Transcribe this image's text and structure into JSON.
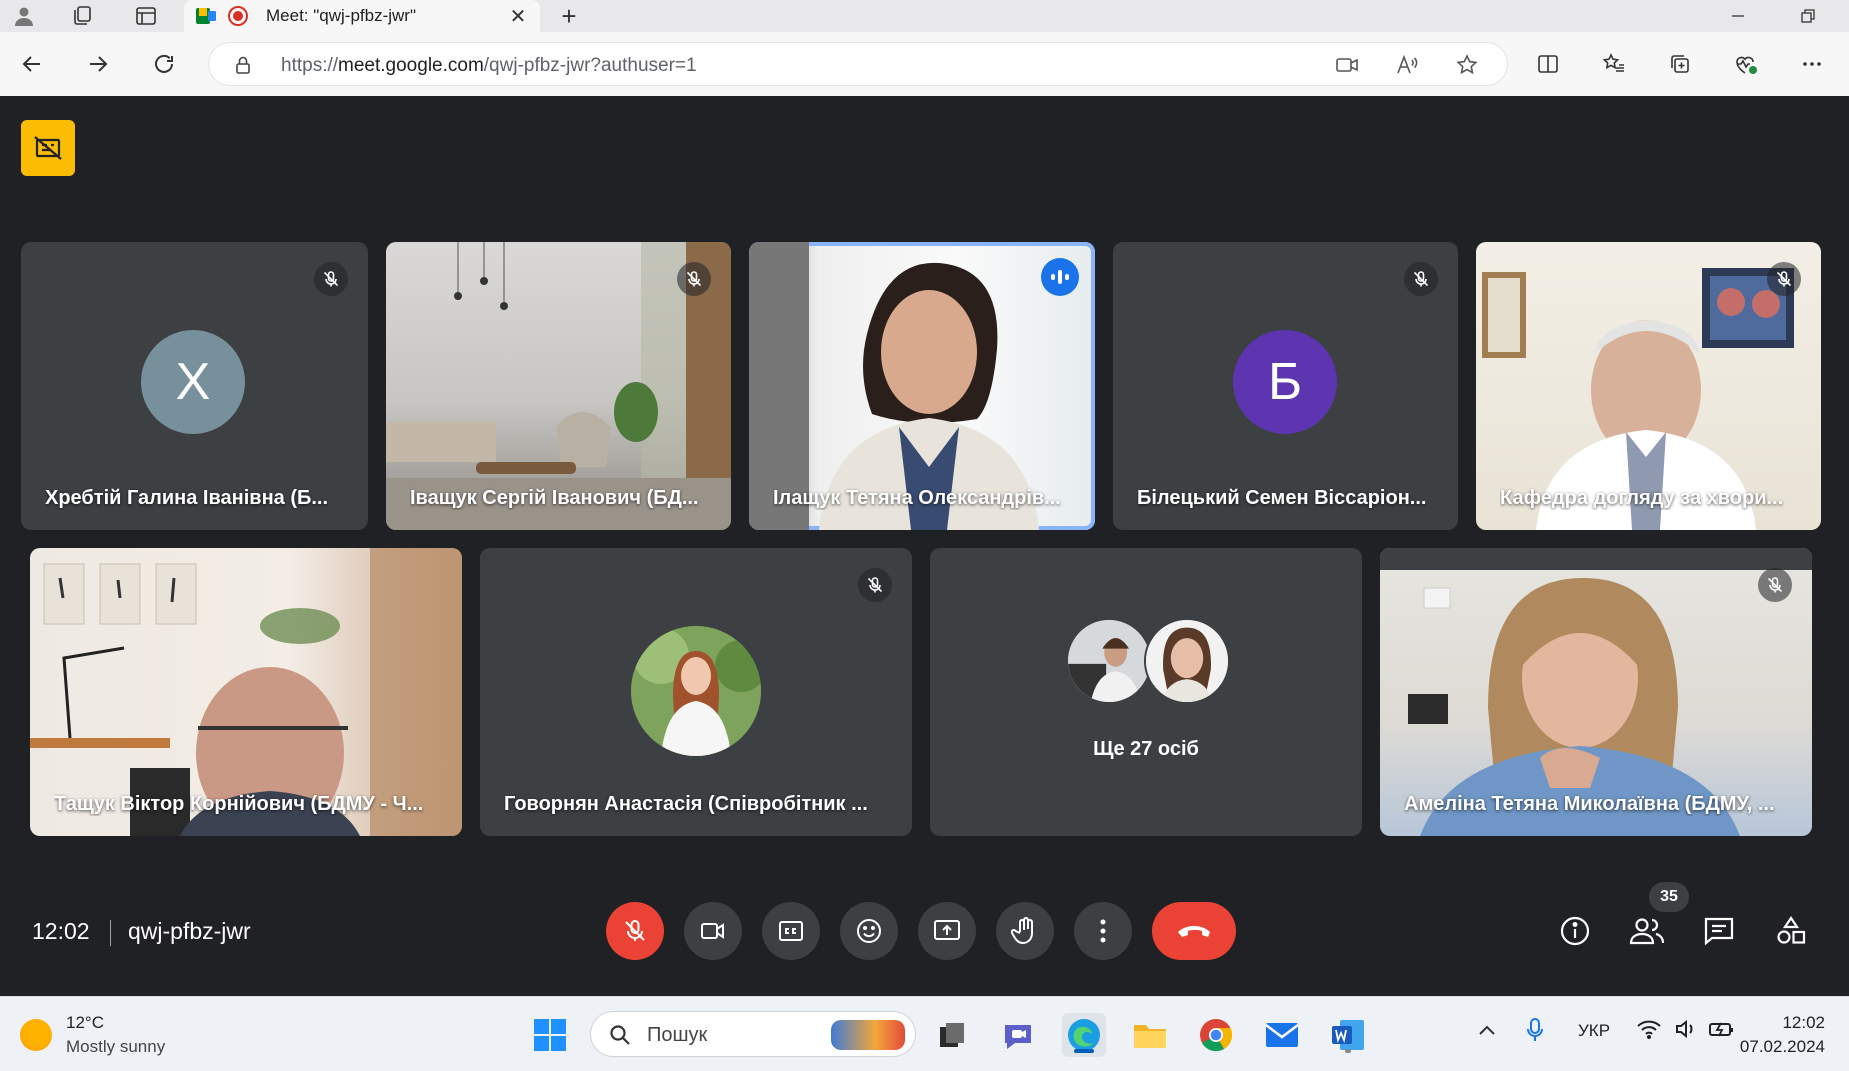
{
  "browser": {
    "tab_title": "Meet: \"qwj-pfbz-jwr\"",
    "url_prefix": "https://",
    "url_domain": "meet.google.com",
    "url_path": "/qwj-pfbz-jwr?authuser=1"
  },
  "meet": {
    "tiles_row1": [
      {
        "name": "Хребтій Галина Іванівна (Б...",
        "avatar_letter": "Х",
        "avatar_color": "#78909c",
        "muted": true
      },
      {
        "name": "Іващук Сергій Іванович (БД...",
        "muted": true
      },
      {
        "name": "Ілащук Тетяна Олександрів...",
        "speaking": true
      },
      {
        "name": "Білецький Семен Віссаріон...",
        "avatar_letter": "Б",
        "avatar_color": "#5e35b1",
        "muted": true
      },
      {
        "name": "Кафедра догляду за хвори...",
        "muted": true
      }
    ],
    "tiles_row2": [
      {
        "name": "Тащук Віктор Корнійович (БДМУ - Ч..."
      },
      {
        "name": "Говорнян Анастасія (Співробітник ...",
        "muted": true
      },
      {
        "more_label": "Ще 27 осіб"
      },
      {
        "name": "Амеліна Тетяна Миколаївна (БДМУ, ...",
        "muted": true
      }
    ],
    "time": "12:02",
    "meeting_code": "qwj-pfbz-jwr",
    "participants_count": "35",
    "colors": {
      "accent": "#1a73e8",
      "danger": "#ea4335",
      "tile": "#3c4043",
      "background": "#202124",
      "highlight": "#fbbc04"
    }
  },
  "taskbar": {
    "weather_temp": "12°C",
    "weather_condition": "Mostly sunny",
    "search_placeholder": "Пошук",
    "language": "УКР",
    "clock_time": "12:02",
    "clock_date": "07.02.2024"
  }
}
